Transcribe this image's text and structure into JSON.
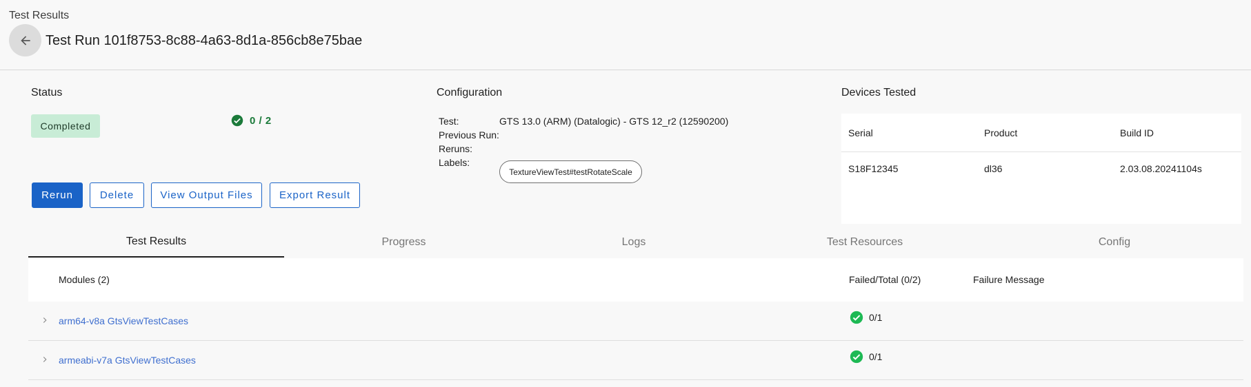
{
  "header": {
    "breadcrumb": "Test Results",
    "title": "Test Run 101f8753-8c88-4a63-8d1a-856cb8e75bae"
  },
  "status": {
    "section_title": "Status",
    "badge": "Completed",
    "count": "0 / 2",
    "buttons": {
      "rerun": "Rerun",
      "delete": "Delete",
      "view_output": "View Output Files",
      "export": "Export Result"
    }
  },
  "configuration": {
    "section_title": "Configuration",
    "test_label": "Test:",
    "test_value": "GTS 13.0 (ARM) (Datalogic) - GTS 12_r2 (12590200)",
    "previous_run_label": "Previous Run:",
    "reruns_label": "Reruns:",
    "labels_label": "Labels:",
    "label_chip": "TextureViewTest#testRotateScale"
  },
  "devices": {
    "section_title": "Devices Tested",
    "columns": {
      "serial": "Serial",
      "product": "Product",
      "build_id": "Build ID"
    },
    "rows": [
      {
        "serial": "S18F12345",
        "product": "dl36",
        "build_id": "2.03.08.20241104s"
      }
    ]
  },
  "tabs": [
    {
      "label": "Test Results",
      "active": true
    },
    {
      "label": "Progress",
      "active": false
    },
    {
      "label": "Logs",
      "active": false
    },
    {
      "label": "Test Resources",
      "active": false
    },
    {
      "label": "Config",
      "active": false
    }
  ],
  "results_table": {
    "headers": {
      "modules": "Modules (2)",
      "failed_total": "Failed/Total (0/2)",
      "failure_message": "Failure Message"
    },
    "rows": [
      {
        "module": "arm64-v8a GtsViewTestCases",
        "result": "0/1"
      },
      {
        "module": "armeabi-v7a GtsViewTestCases",
        "result": "0/1"
      }
    ]
  },
  "colors": {
    "primary": "#1a63c7",
    "success": "#1db954",
    "badge_bg": "#c8ecd6",
    "link": "#3f6fcf"
  },
  "icons": {
    "back": "arrow-left-icon",
    "pass": "check-circle-icon",
    "expand": "chevron-right-icon"
  }
}
